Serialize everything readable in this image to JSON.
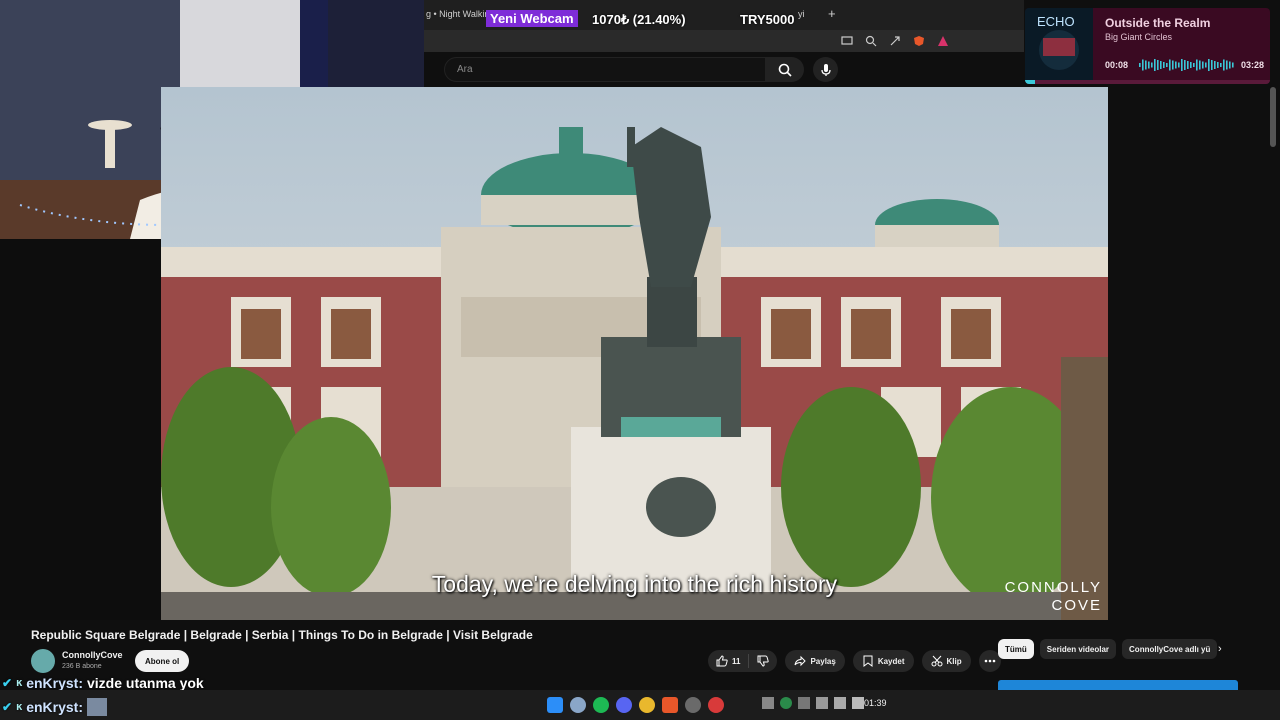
{
  "browser": {
    "tab_left_title": "g • Night Walkin",
    "tab_right_fragment": "yi",
    "new_tab": "+"
  },
  "overlay": {
    "webcam_tag": "Yeni Webcam",
    "stat_center": "1070₺ (21.40%)",
    "stat_right": "TRY5000"
  },
  "youtube": {
    "search_placeholder": "Ara",
    "video": {
      "subtitle": "Today, we're delving into the rich history",
      "watermark_line1": "CONNOLLY",
      "watermark_line2": "COVE"
    },
    "title": "Republic Square Belgrade | Belgrade | Serbia | Things To Do in Belgrade | Visit Belgrade",
    "channel": {
      "name": "ConnollyCove",
      "subscribers": "236 B abone",
      "subscribe_label": "Abone ol"
    },
    "actions": {
      "like_count": "11",
      "share": "Paylaş",
      "save": "Kaydet",
      "clip": "Klip"
    },
    "chips": [
      "Tümü",
      "Seriden videolar",
      "ConnollyCove adlı yü"
    ]
  },
  "music": {
    "title": "Outside the Realm",
    "artist": "Big Giant Circles",
    "time_current": "00:08",
    "time_total": "03:28",
    "progress": 0.04,
    "album_text": "ECHO"
  },
  "chat": [
    {
      "user": "enKryst:",
      "message": "vizde utanma yok"
    },
    {
      "user": "enKryst:",
      "message": ""
    }
  ],
  "taskbar": {
    "clock": "01:39"
  },
  "colors": {
    "accent_purple": "#7e2cd8",
    "music_bg": "#3a0a22",
    "progress": "#3ac8d8"
  }
}
